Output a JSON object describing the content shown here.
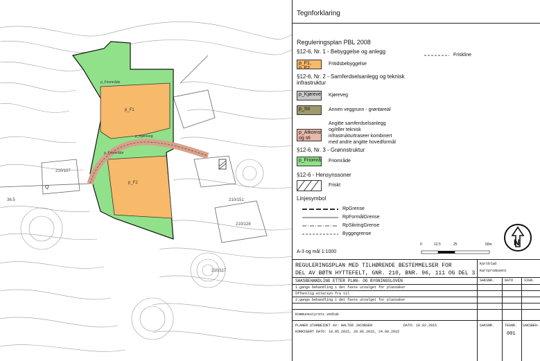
{
  "map": {
    "labels": [
      "p_F1",
      "p_F2",
      "p_Kjøreveg",
      "p_Friområde",
      "p_Friområde",
      "210/151",
      "210/107",
      "210/128",
      "210/117",
      "36.5",
      "Q"
    ]
  },
  "legend": {
    "title": "Tegnforklaring",
    "plan_heading": "Reguleringsplan PBL 2008",
    "sections": {
      "s1": "§12-6, Nr. 1 - Bebyggelse og anlegg",
      "s2": "§12-6, Nr. 2 - Samferdselsanlegg og teknisk infrastruktur",
      "s3": "§12-6, Nr. 3 - Grønnstruktur",
      "s4": "§12-6 - Hensynssoner",
      "s5": "Linjesymbol"
    },
    "items": {
      "fritid_code": "p_F1, p_F2",
      "fritid_label": "Fritidsbebyggelse",
      "kjoreveg_code": "p_Kjøreveg",
      "kjoreveg_label": "Kjøreveg",
      "sti_code": "p_Sti",
      "sti_label": "Annen veggrunn - grøntareal",
      "alkomst_code": "p_Atkomst og sti",
      "alkomst_label_1": "Angitte samferdselsanlegg",
      "alkomst_label_2": "og/eller teknisk",
      "alkomst_label_3": "infrastrukturtraseer kombinert",
      "alkomst_label_4": "med andre angitte hovedformål",
      "friomrade_code": "p_Friområde",
      "friomrade_label": "Friområde",
      "friskt_label": "Friskt",
      "friskline_label": "Friskline"
    },
    "lines": {
      "rpgrense": "RpGrense",
      "rpformal": "RpFormålGrense",
      "rpsikring": "RpSikringGrense",
      "byggegrense": "Byggegrense"
    },
    "scale_text": "A-3 og mål 1:1000",
    "scale_ticks": [
      "0",
      "12.5",
      "25",
      "50m"
    ],
    "colors": {
      "orange": "#f7b96a",
      "green": "#91e18a",
      "gray": "#c9c9c9",
      "olive": "#9d9a6b",
      "tan": "#e8b8a8"
    }
  },
  "title_block": {
    "title_line_1": "REGULERINGSPLAN MED TILHØRENDE BESTEMMELSER FOR",
    "title_line_2": "DEL AV BØTN HYTTEFELT, GNR. 210, BNR. 96, 111 OG DEL 3",
    "kartblad": "Kartblad",
    "kartprodusent": "Kartprodusent",
    "header_row": "SAKSBEHANDLING ETTER PLAN- OG BYGNINGSLOVEN",
    "col_saksnr": "SAKSNR.",
    "col_dato": "DATO",
    "col_sign": "SIGN.",
    "rows": [
      "1.gangs behandling i det faste utvalget for plansaker",
      "Offentlig ettersyn fra            til",
      "2.gangs behandling i det faste utvalget for plansaker",
      "",
      "Kommunestyrets vedtak"
    ],
    "prepared_by": "PLANEN UTARBEIDET AV: WALTER JACOBSEN",
    "prepared_date": "DATO: 18.02.2015",
    "revised": "KORRIGERT DATO: 10.05.2015, 20.06.2015, 24.09.2015",
    "col_saksnr2": "SAKSNR.",
    "col_tegnnr": "TEGNR.",
    "col_saksbeh": "SAKSBEH.",
    "tegn_no": "001"
  }
}
